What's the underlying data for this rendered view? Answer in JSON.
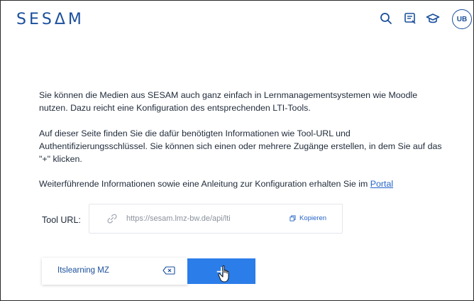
{
  "header": {
    "logo": "SESΔM",
    "icons": [
      "search-icon",
      "notes-icon",
      "graduation-cap-icon"
    ],
    "avatar_initials": "UB"
  },
  "content": {
    "para1": "Sie können die Medien aus SESAM auch ganz einfach in Lernmanagementsystemen wie Moodle nutzen. Dazu reicht eine Konfiguration des entsprechenden LTI-Tools.",
    "para2": "Auf dieser Seite finden Sie die dafür benötigten Informationen wie Tool-URL und Authentifizierungsschlüssel. Sie können sich einen oder mehrere Zugänge erstellen, in dem Sie auf das \"+\" klicken.",
    "para3_text": "Weiterführende Informationen sowie eine Anleitung zur Konfiguration erhalten Sie im ",
    "para3_link": "Portal"
  },
  "tool": {
    "label": "Tool URL:",
    "url": "https://sesam.lmz-bw.de/api/lti",
    "copy_label": "Kopieren"
  },
  "access": {
    "name": "Itslearning MZ",
    "add_label": "+"
  },
  "colors": {
    "brand": "#1a4f9c",
    "accent": "#2b7de9",
    "link": "#2563c9"
  }
}
